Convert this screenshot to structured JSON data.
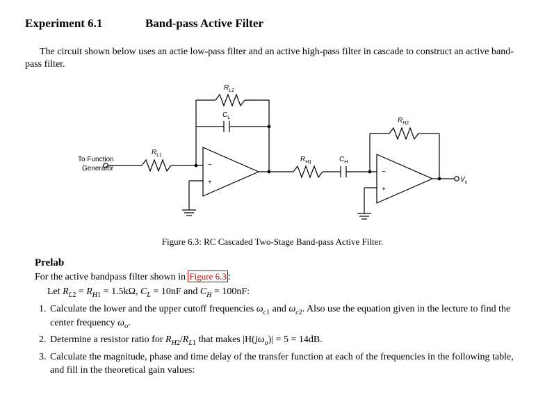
{
  "header": {
    "experiment_label": "Experiment 6.1",
    "title": "Band-pass Active Filter"
  },
  "intro": "The circuit shown below uses an actie low-pass filter and an active high-pass filter in cascade to construct an active band-pass filter.",
  "figure": {
    "caption": "Figure 6.3:  RC Cascaded Two-Stage Band-pass Active Filter.",
    "labels": {
      "input1": "To Function",
      "input2": "Generator",
      "RL1": "R",
      "RL1_sub": "L1",
      "RL2": "R",
      "RL2_sub": "L2",
      "CL": "C",
      "CL_sub": "L",
      "RH1": "R",
      "RH1_sub": "H1",
      "CH": "C",
      "CH_sub": "H",
      "RH2": "R",
      "RH2_sub": "H2",
      "Vout": "V",
      "Vout_sub": "out"
    }
  },
  "prelab": {
    "heading": "Prelab",
    "intro_prefix": "For the active bandpass filter shown in ",
    "figref": "Figure 6.3",
    "intro_suffix": ":",
    "let_line": "Let R_{L2} = R_{H1} = 1.5kΩ, C_L = 10nF and C_H = 100nF:",
    "items": [
      "Calculate the lower and the upper cutoff frequencies ω_{c1} and ω_{c2}. Also use the equation given in the lecture to find the center frequency ω_o.",
      "Determine a resistor ratio for R_{H2}/R_{L1} that makes |H(jω_o)| = 5 = 14dB.",
      "Calculate the magnitude, phase and time delay of the transfer function at each of the frequencies in the following table, and fill in the theoretical gain values:"
    ]
  }
}
